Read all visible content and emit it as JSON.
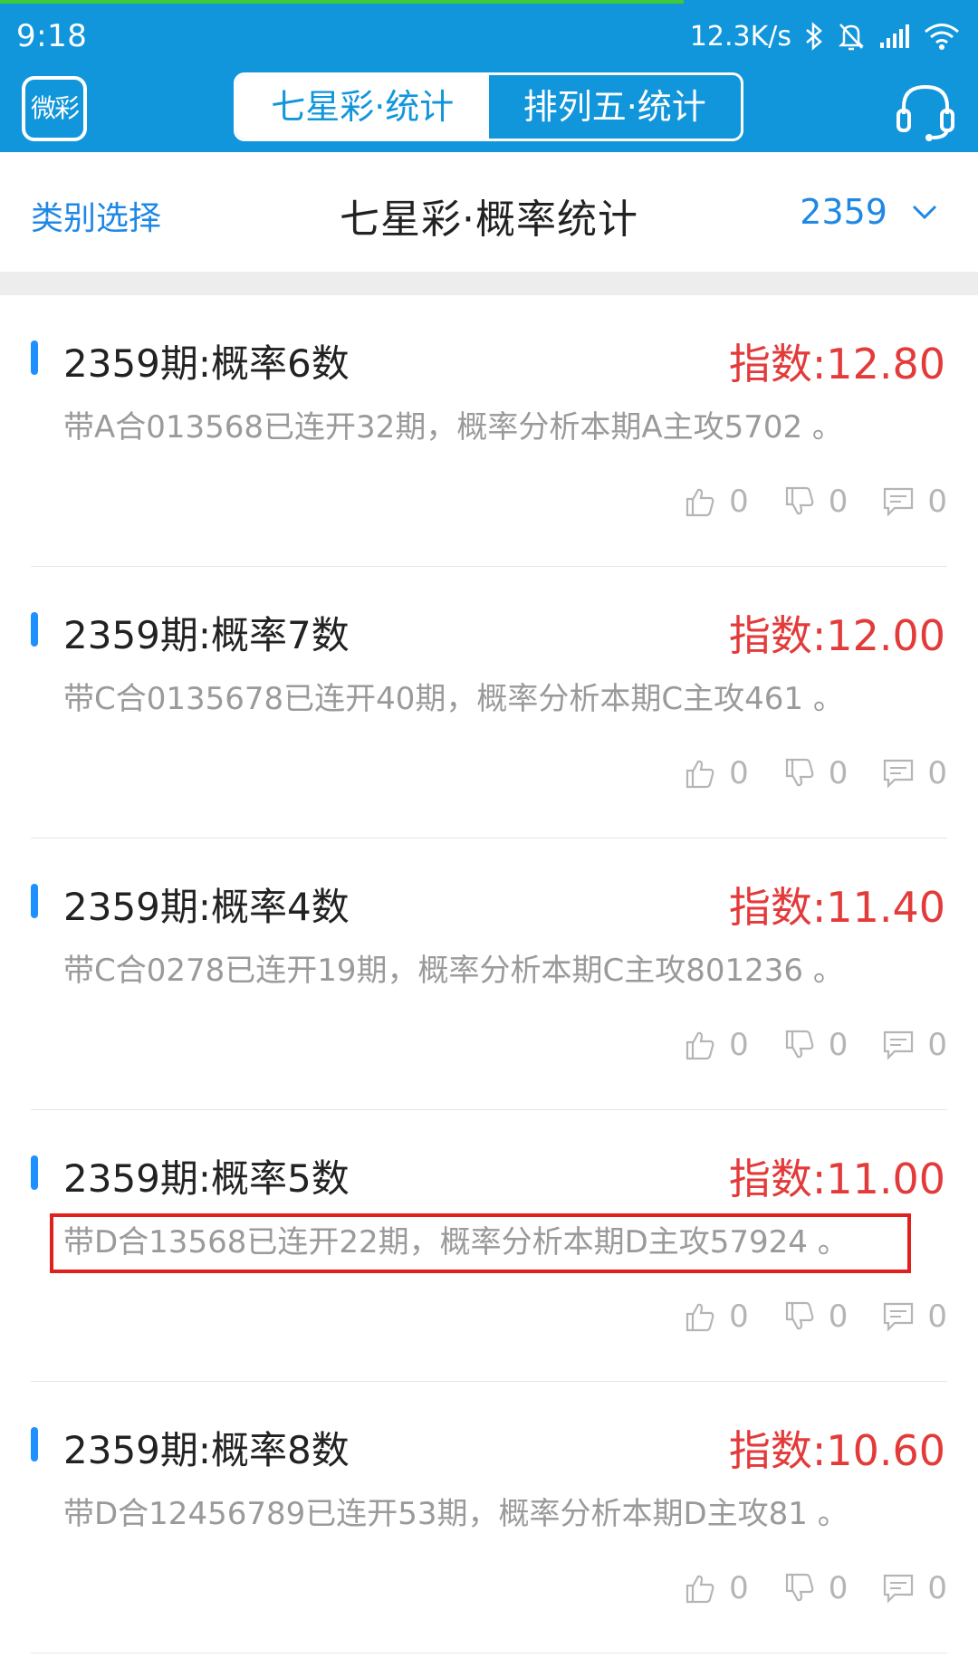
{
  "status_bar": {
    "time": "9:18",
    "net_speed": "12.3K/s",
    "icons": [
      "bluetooth-icon",
      "mute-icon",
      "signal-icon",
      "wifi-icon"
    ]
  },
  "nav": {
    "logo_text": "微彩",
    "tabs": [
      {
        "label": "七星彩·统计",
        "active": true
      },
      {
        "label": "排列五·统计",
        "active": false
      }
    ],
    "support_icon": "headset-icon"
  },
  "sub_header": {
    "category_label": "类别选择",
    "title": "七星彩·概率统计",
    "period": "2359"
  },
  "items": [
    {
      "title": "2359期:概率6数",
      "index": "指数:12.80",
      "desc": "带A合013568已连开32期，概率分析本期A主攻5702 。",
      "likes": "0",
      "dislikes": "0",
      "comments": "0"
    },
    {
      "title": "2359期:概率7数",
      "index": "指数:12.00",
      "desc": "带C合0135678已连开40期，概率分析本期C主攻461 。",
      "likes": "0",
      "dislikes": "0",
      "comments": "0"
    },
    {
      "title": "2359期:概率4数",
      "index": "指数:11.40",
      "desc": "带C合0278已连开19期，概率分析本期C主攻801236 。",
      "likes": "0",
      "dislikes": "0",
      "comments": "0"
    },
    {
      "title": "2359期:概率5数",
      "index": "指数:11.00",
      "desc": "带D合13568已连开22期，概率分析本期D主攻57924 。",
      "likes": "0",
      "dislikes": "0",
      "comments": "0"
    },
    {
      "title": "2359期:概率8数",
      "index": "指数:10.60",
      "desc": "带D合12456789已连开53期，概率分析本期D主攻81 。",
      "likes": "0",
      "dislikes": "0",
      "comments": "0"
    }
  ],
  "colors": {
    "brand_blue": "#1296db",
    "index_red": "#e33a3a",
    "highlight_red": "#e0201c"
  }
}
